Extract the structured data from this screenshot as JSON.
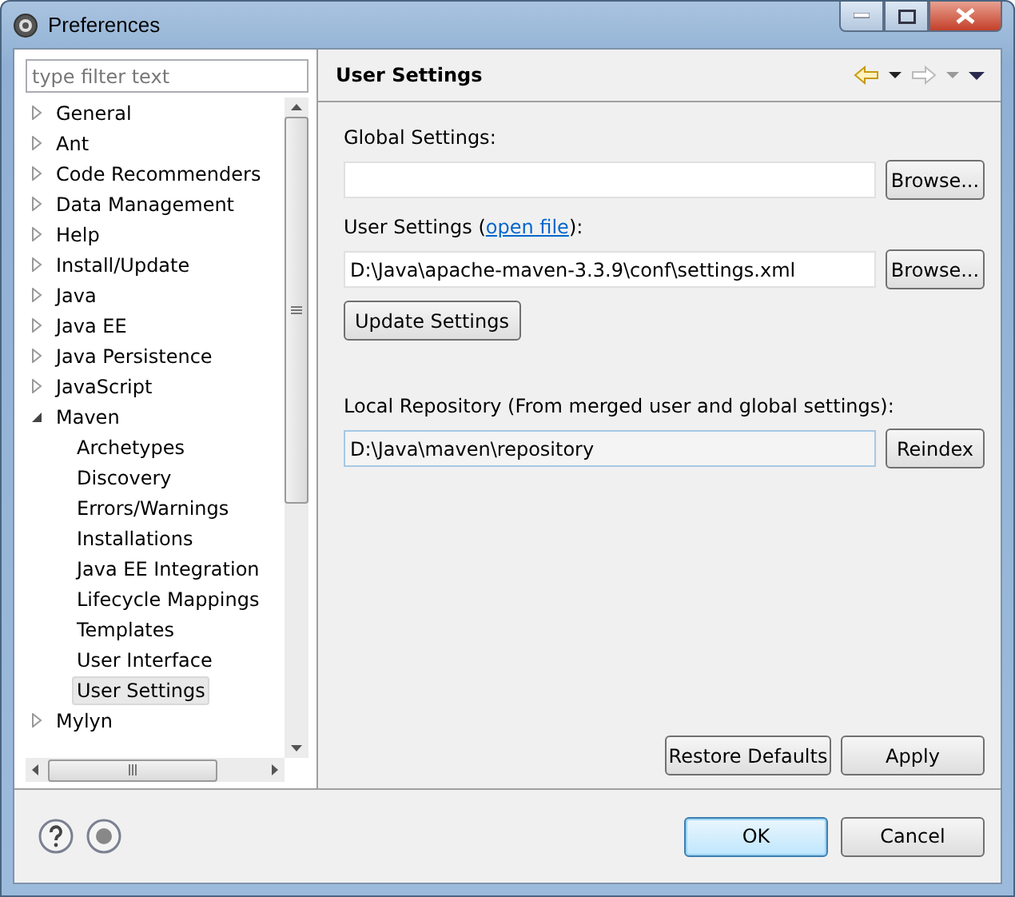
{
  "window": {
    "title": "Preferences"
  },
  "filter": {
    "placeholder": "type filter text"
  },
  "tree": [
    {
      "label": "General",
      "expanded": false,
      "selected": false
    },
    {
      "label": "Ant",
      "expanded": false,
      "selected": false
    },
    {
      "label": "Code Recommenders",
      "expanded": false,
      "selected": false
    },
    {
      "label": "Data Management",
      "expanded": false,
      "selected": false
    },
    {
      "label": "Help",
      "expanded": false,
      "selected": false
    },
    {
      "label": "Install/Update",
      "expanded": false,
      "selected": false
    },
    {
      "label": "Java",
      "expanded": false,
      "selected": false
    },
    {
      "label": "Java EE",
      "expanded": false,
      "selected": false
    },
    {
      "label": "Java Persistence",
      "expanded": false,
      "selected": false
    },
    {
      "label": "JavaScript",
      "expanded": false,
      "selected": false
    },
    {
      "label": "Maven",
      "expanded": true,
      "selected": false,
      "children": [
        {
          "label": "Archetypes",
          "selected": false
        },
        {
          "label": "Discovery",
          "selected": false
        },
        {
          "label": "Errors/Warnings",
          "selected": false
        },
        {
          "label": "Installations",
          "selected": false
        },
        {
          "label": "Java EE Integration",
          "selected": false
        },
        {
          "label": "Lifecycle Mappings",
          "selected": false
        },
        {
          "label": "Templates",
          "selected": false
        },
        {
          "label": "User Interface",
          "selected": false
        },
        {
          "label": "User Settings",
          "selected": true
        }
      ]
    },
    {
      "label": "Mylyn",
      "expanded": false,
      "selected": false
    }
  ],
  "page": {
    "title": "User Settings",
    "global_label": "Global Settings:",
    "user_label": "User Settings (",
    "user_link": "open file",
    "user_label_end": "):",
    "user_value": "D:\\Java\\apache-maven-3.3.9\\conf\\settings.xml",
    "browse_buttons": [
      "Browse...",
      "Browse..."
    ],
    "update_button": "Update Settings",
    "repo_label": "Local Repository (From merged user and global settings):",
    "repo_value": "D:\\Java\\maven\\repository",
    "reindex_button": "Reindex",
    "restore_button": "Restore Defaults",
    "apply_button": "Apply"
  },
  "buttons": [
    {
      "label": "OK",
      "default": true
    },
    {
      "label": "Cancel",
      "default": false
    }
  ]
}
